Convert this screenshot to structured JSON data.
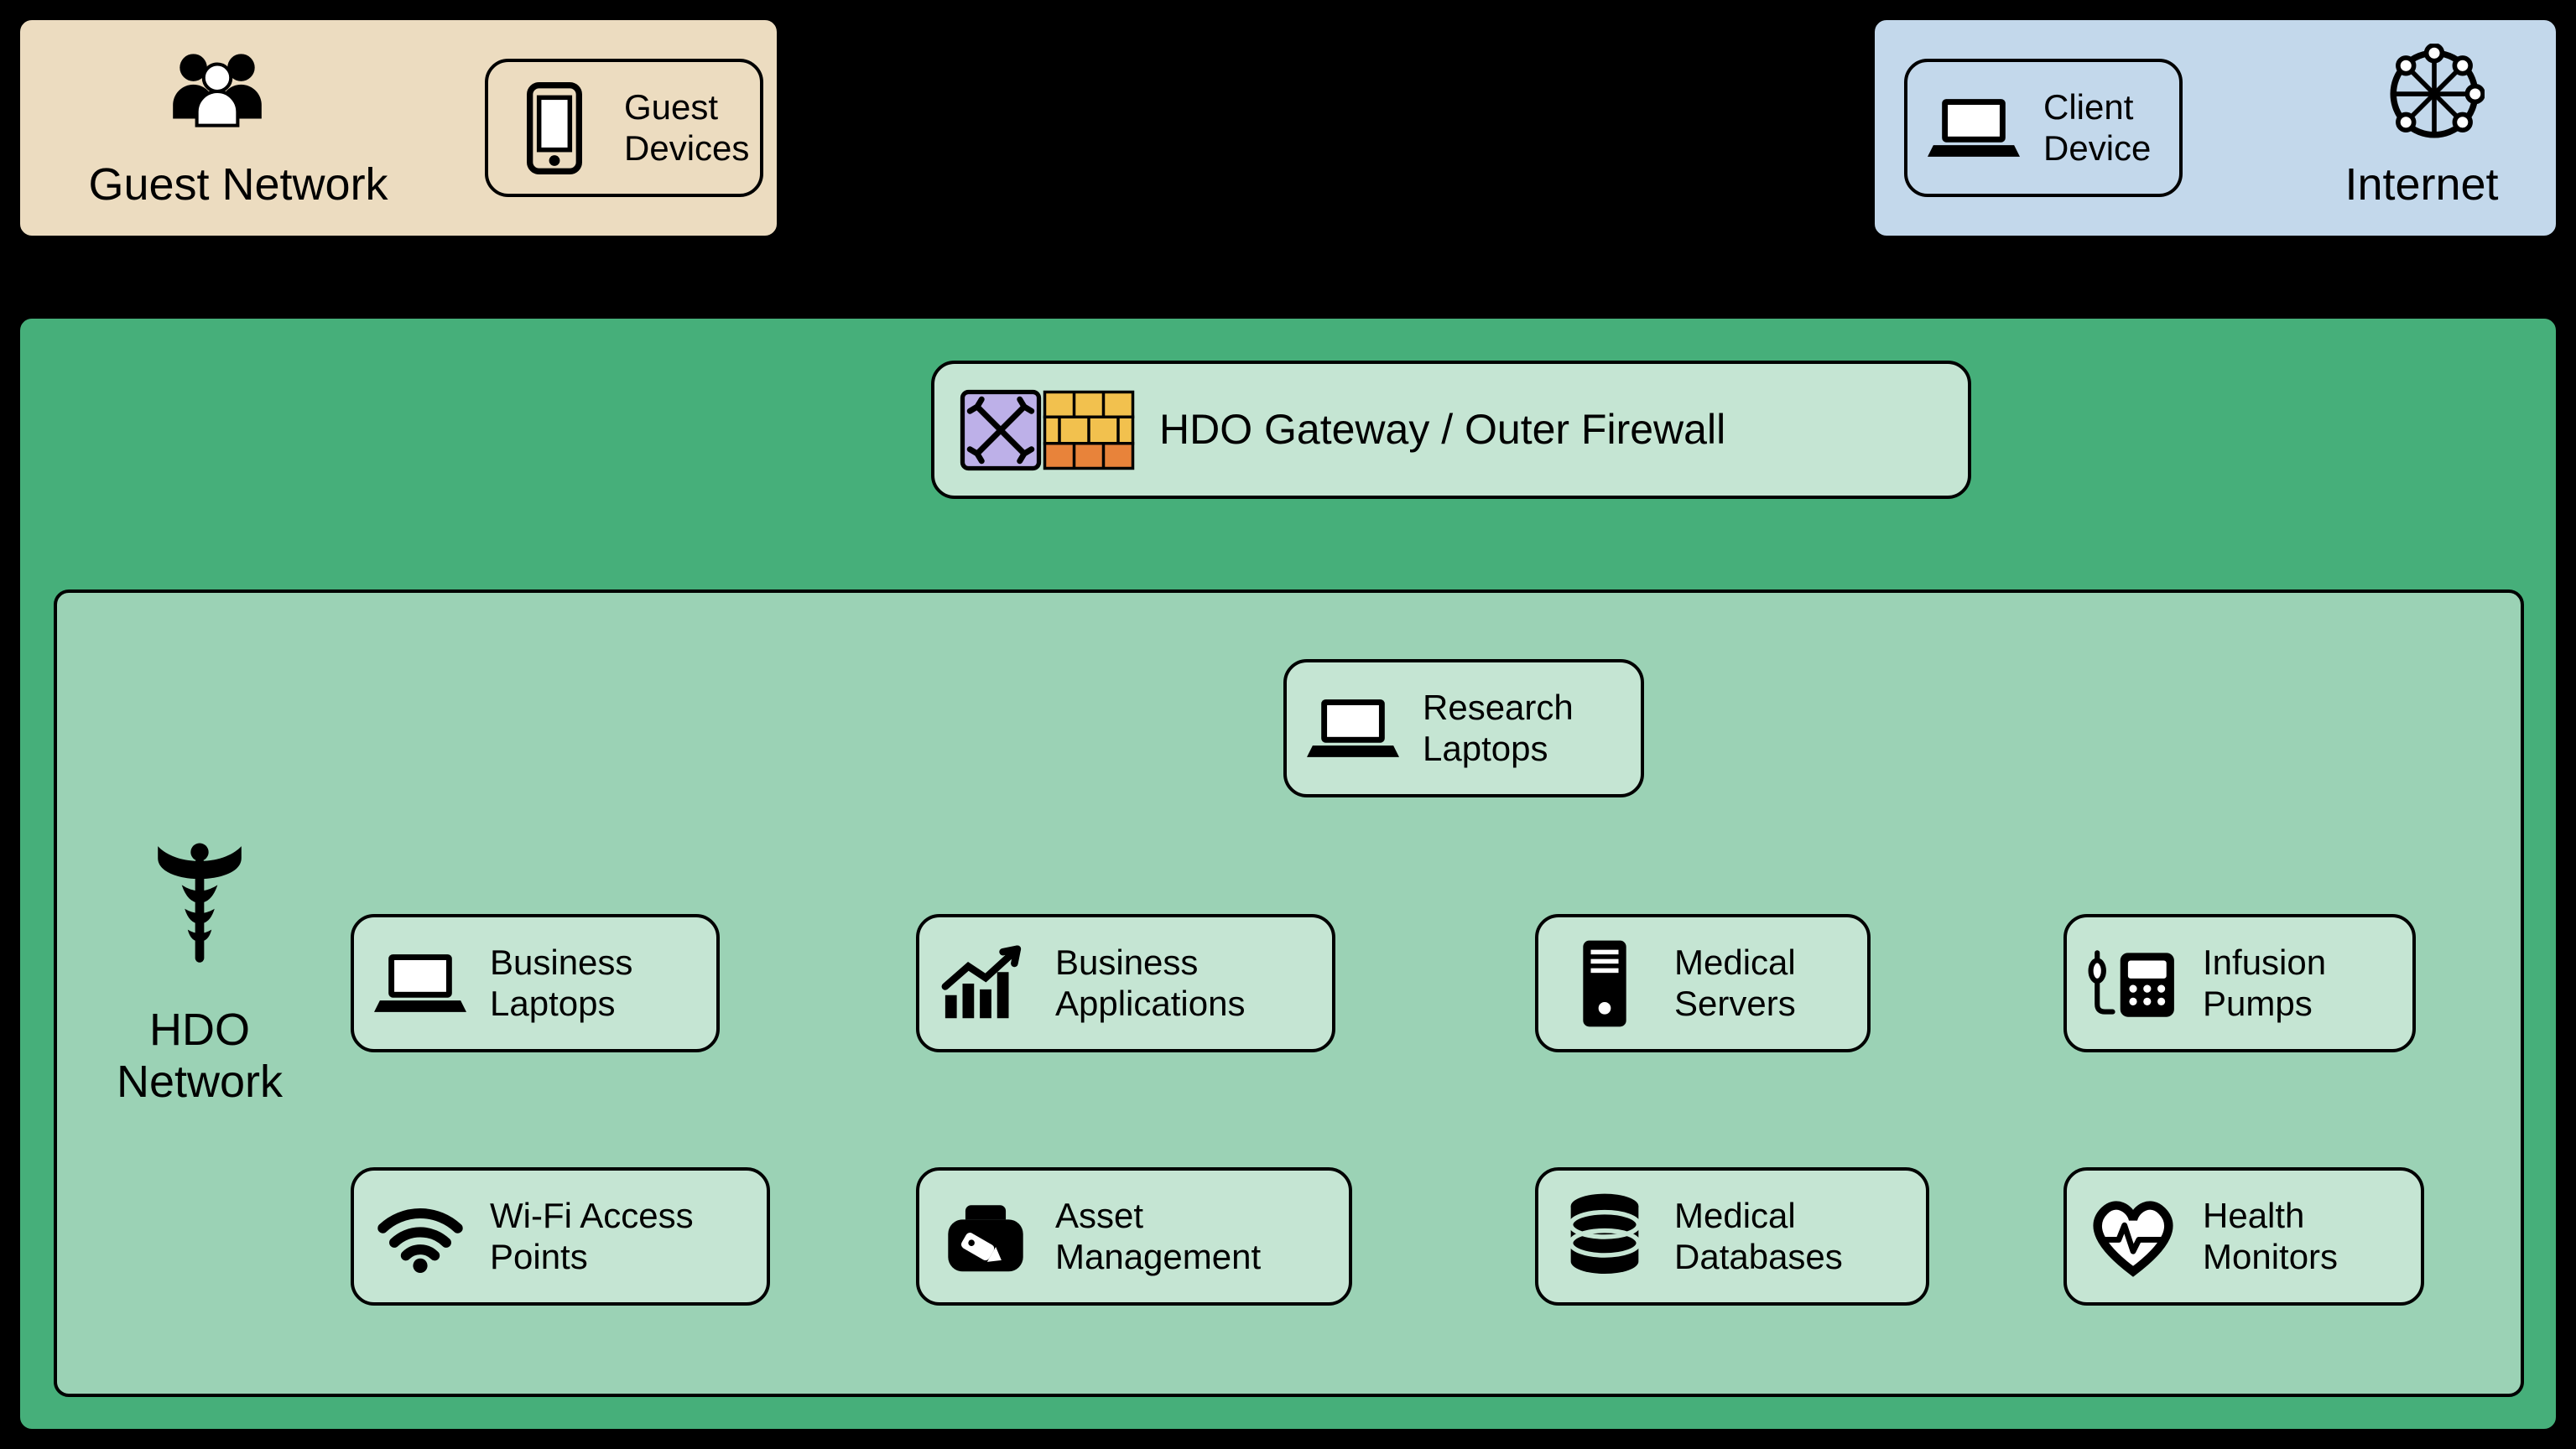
{
  "zones": {
    "guest": {
      "title": "Guest Network"
    },
    "internet": {
      "title": "Internet"
    },
    "hdo": {
      "title": "HDO\nNetwork"
    }
  },
  "nodes": {
    "guest_devices": {
      "label": "Guest\nDevices"
    },
    "client_device": {
      "label": "Client\nDevice"
    },
    "gateway": {
      "label": "HDO Gateway / Outer Firewall"
    },
    "research_laptops": {
      "label": "Research\nLaptops"
    },
    "business_laptops": {
      "label": "Business\nLaptops"
    },
    "business_apps": {
      "label": "Business\nApplications"
    },
    "medical_servers": {
      "label": "Medical\nServers"
    },
    "infusion_pumps": {
      "label": "Infusion\nPumps"
    },
    "wifi_aps": {
      "label": "Wi-Fi Access\nPoints"
    },
    "asset_mgmt": {
      "label": "Asset\nManagement"
    },
    "medical_db": {
      "label": "Medical\nDatabases"
    },
    "health_monitors": {
      "label": "Health\nMonitors"
    }
  },
  "colors": {
    "guest_bg": "#ecdcc0",
    "internet_bg": "#c3d8eb",
    "hdo_outer_bg": "#46af7a",
    "hdo_inner_bg": "#9bd2b5",
    "node_bg": "#c5e5d3"
  }
}
